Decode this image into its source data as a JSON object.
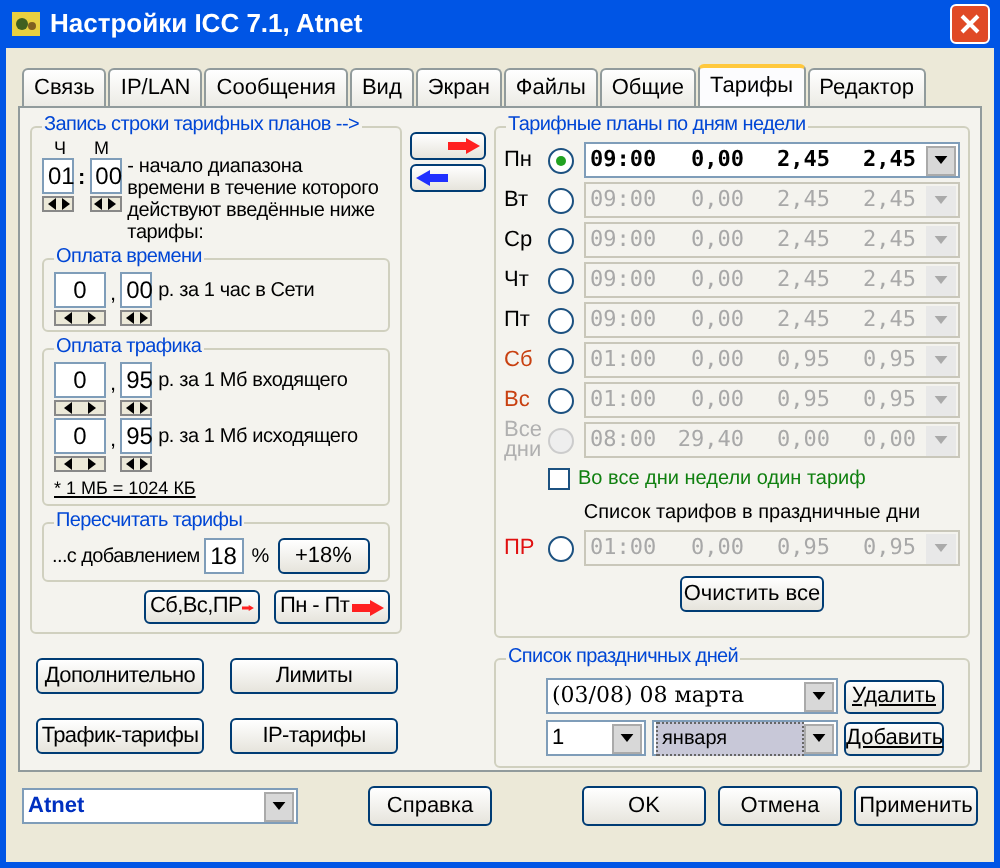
{
  "window": {
    "title": "Настройки ICC 7.1, Atnet"
  },
  "tabs": [
    {
      "label": "Связь",
      "selected": false
    },
    {
      "label": "IP/LAN",
      "selected": false
    },
    {
      "label": "Сообщения",
      "selected": false
    },
    {
      "label": "Вид",
      "selected": false
    },
    {
      "label": "Экран",
      "selected": false
    },
    {
      "label": "Файлы",
      "selected": false
    },
    {
      "label": "Общие",
      "selected": false
    },
    {
      "label": "Тарифы",
      "selected": true
    },
    {
      "label": "Редактор",
      "selected": false
    }
  ],
  "schedule_entry": {
    "title": "Запись строки тарифных планов -->",
    "hour_label": "Ч",
    "minute_label": "М",
    "hour": "01",
    "separator": ":",
    "minute": "00",
    "description": "- начало диапазона времени в течение которого действуют введённые ниже тарифы:"
  },
  "time_payment": {
    "title": "Оплата времени",
    "rub": "0",
    "comma": ",",
    "kop": "00",
    "unit": "р. за 1 час в Сети"
  },
  "traffic_payment": {
    "title": "Оплата трафика",
    "rows": [
      {
        "rub": "0",
        "comma": ",",
        "kop": "95",
        "unit": "р. за 1 Мб входящего"
      },
      {
        "rub": "0",
        "comma": ",",
        "kop": "95",
        "unit": "р. за 1 Мб исходящего"
      }
    ],
    "note": "* 1 МБ = 1024 КБ"
  },
  "recalc": {
    "title": "Пересчитать тарифы",
    "label": "...с добавлением",
    "percent": "18",
    "percent_sign": "%",
    "button": "+18%"
  },
  "copy_buttons": [
    "Сб,Вс,ПР",
    "Пн - Пт"
  ],
  "weekday_plans": {
    "title": "Тарифные планы по дням недели",
    "days": [
      {
        "label": "Пн",
        "color": "#000000",
        "selected": true,
        "active": true,
        "values": [
          "09:00",
          "0,00",
          "2,45",
          "2,45"
        ]
      },
      {
        "label": "Вт",
        "color": "#000000",
        "selected": false,
        "active": false,
        "values": [
          "09:00",
          "0,00",
          "2,45",
          "2,45"
        ]
      },
      {
        "label": "Ср",
        "color": "#000000",
        "selected": false,
        "active": false,
        "values": [
          "09:00",
          "0,00",
          "2,45",
          "2,45"
        ]
      },
      {
        "label": "Чт",
        "color": "#000000",
        "selected": false,
        "active": false,
        "values": [
          "09:00",
          "0,00",
          "2,45",
          "2,45"
        ]
      },
      {
        "label": "Пт",
        "color": "#000000",
        "selected": false,
        "active": false,
        "values": [
          "09:00",
          "0,00",
          "2,45",
          "2,45"
        ]
      },
      {
        "label": "Сб",
        "color": "#c84010",
        "selected": false,
        "active": false,
        "values": [
          "01:00",
          "0,00",
          "0,95",
          "0,95"
        ]
      },
      {
        "label": "Вс",
        "color": "#c84010",
        "selected": false,
        "active": false,
        "values": [
          "01:00",
          "0,00",
          "0,95",
          "0,95"
        ]
      },
      {
        "label": "Все дни",
        "color": "#b0b0b0",
        "selected": false,
        "active": false,
        "disabled": true,
        "values": [
          "08:00",
          "29,40",
          "0,00",
          "0,00"
        ]
      }
    ],
    "all_days": {
      "label": "Во все дни недели один тариф",
      "checked": false
    },
    "holiday_title": "Список тарифов в праздничные дни",
    "holiday_row": {
      "label": "ПР",
      "color": "#e01010",
      "selected": false,
      "active": false,
      "values": [
        "01:00",
        "0,00",
        "0,95",
        "0,95"
      ]
    },
    "clear_button": "Очистить все"
  },
  "holidays": {
    "title": "Список праздничных дней",
    "current": "(03/08) 08 марта",
    "delete": "Удалить",
    "day": "1",
    "month": "января",
    "add": "Добавить"
  },
  "side_buttons": [
    "Дополнительно",
    "Лимиты",
    "Трафик-тарифы",
    "IP-тарифы"
  ],
  "bottom": {
    "profile": "Atnet",
    "help": "Справка",
    "buttons": [
      "OK",
      "Отмена",
      "Применить"
    ]
  }
}
